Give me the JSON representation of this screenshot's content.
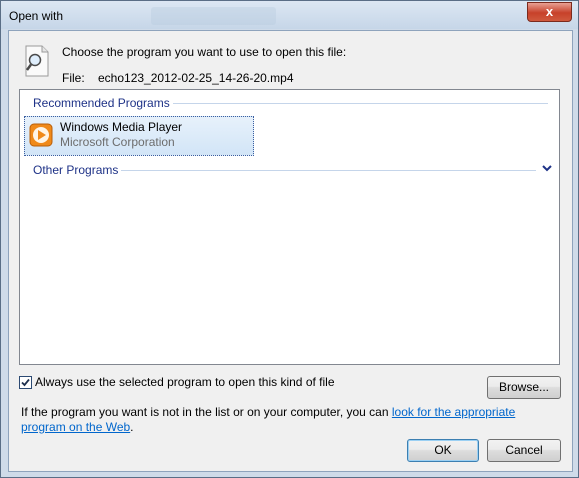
{
  "window": {
    "title": "Open with",
    "close_label": "x"
  },
  "header": {
    "prompt": "Choose the program you want to use to open this file:",
    "file_label": "File:",
    "file_name": "echo123_2012-02-25_14-26-20.mp4"
  },
  "programs": {
    "recommended_label": "Recommended Programs",
    "other_label": "Other Programs",
    "items": [
      {
        "name": "Windows Media Player",
        "company": "Microsoft Corporation",
        "selected": true
      }
    ]
  },
  "options": {
    "always_use_label": "Always use the selected program to open this kind of file",
    "always_use_checked": true,
    "browse_label": "Browse..."
  },
  "info": {
    "text_before": "If the program you want is not in the list or on your computer, you can ",
    "link_text": "look for the appropriate program on the Web",
    "text_after": "."
  },
  "buttons": {
    "ok_label": "OK",
    "cancel_label": "Cancel"
  },
  "colors": {
    "group_header": "#1e3287",
    "link": "#0066cc",
    "selection": "#d2e5f7"
  }
}
